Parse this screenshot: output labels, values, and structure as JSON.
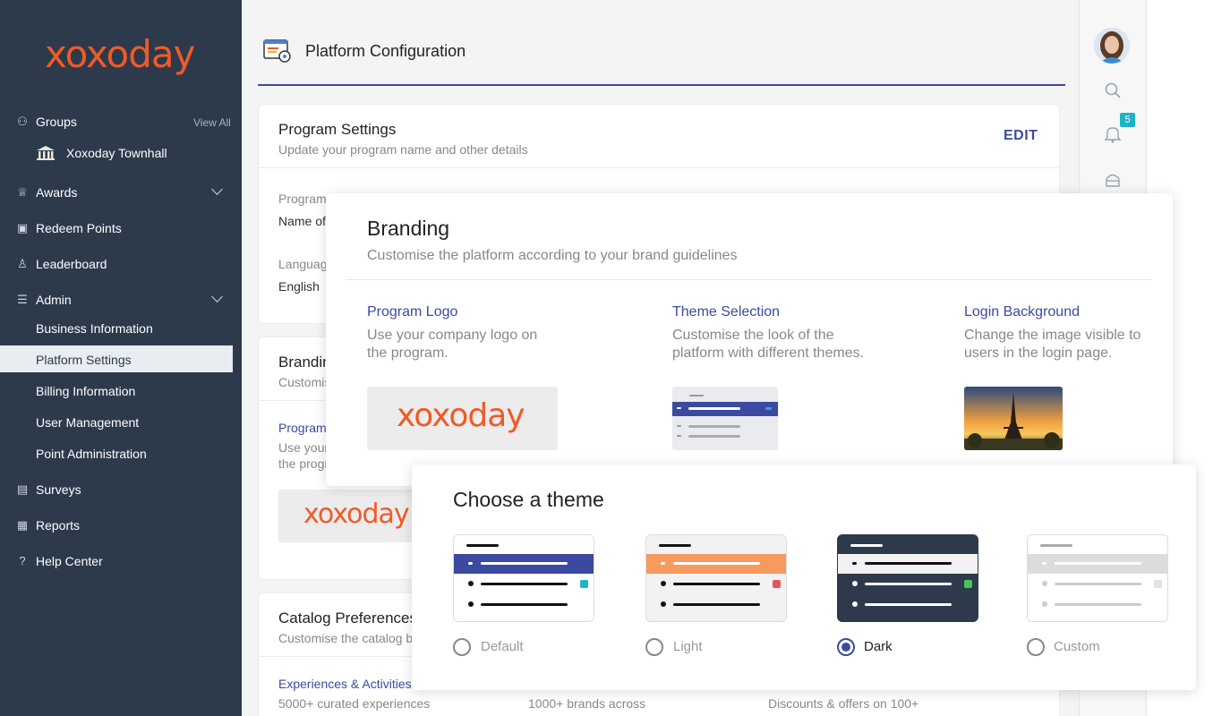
{
  "sidebar": {
    "brand": "xoxoday",
    "groups_label": "Groups",
    "view_all": "View All",
    "group_item": "Xoxoday Townhall",
    "awards": "Awards",
    "redeem": "Redeem Points",
    "leaderboard": "Leaderboard",
    "admin": "Admin",
    "admin_items": [
      "Business Information",
      "Platform Settings",
      "Billing Information",
      "User Management",
      "Point Administration"
    ],
    "surveys": "Surveys",
    "reports": "Reports",
    "help": "Help Center"
  },
  "header": {
    "title": "Platform Configuration"
  },
  "program_settings": {
    "title": "Program Settings",
    "subtitle": "Update your program name and other details",
    "edit": "EDIT",
    "field1_label": "Program",
    "field1_value": "Name of",
    "field2_label": "Language",
    "field2_value": "English"
  },
  "branding_bg": {
    "title": "Brandin",
    "subtitle": "Customis",
    "link": "Program",
    "text": "Use your",
    "text2": "the progr"
  },
  "catalog": {
    "title": "Catalog Preferences",
    "subtitle": "Customise the catalog b",
    "col1_link": "Experiences & Activities",
    "col1_text": "5000+ curated experiences",
    "col2_text": "1000+ brands across",
    "col3_text": "Discounts & offers on 100+"
  },
  "notifications": {
    "count": "5"
  },
  "branding": {
    "title": "Branding",
    "subtitle": "Customise the platform according to your brand guidelines",
    "logo_title": "Program Logo",
    "logo_desc1": "Use your company logo on",
    "logo_desc2": "the program.",
    "theme_title": "Theme Selection",
    "theme_desc1": "Customise the look of the",
    "theme_desc2": "platform with different themes.",
    "login_title": "Login Background",
    "login_desc1": "Change the image visible to",
    "login_desc2": "users in the login page."
  },
  "theme_dialog": {
    "title": "Choose a theme",
    "options": [
      "Default",
      "Light",
      "Dark",
      "Custom"
    ],
    "selected": "Dark"
  },
  "colors": {
    "brand": "#f05a28",
    "sidebar": "#2c3a4b",
    "accent": "#3b4aa0",
    "default_theme": "#3b4aa0",
    "light_theme": "#f79a5e",
    "dark_theme": "#2c3a4b"
  }
}
